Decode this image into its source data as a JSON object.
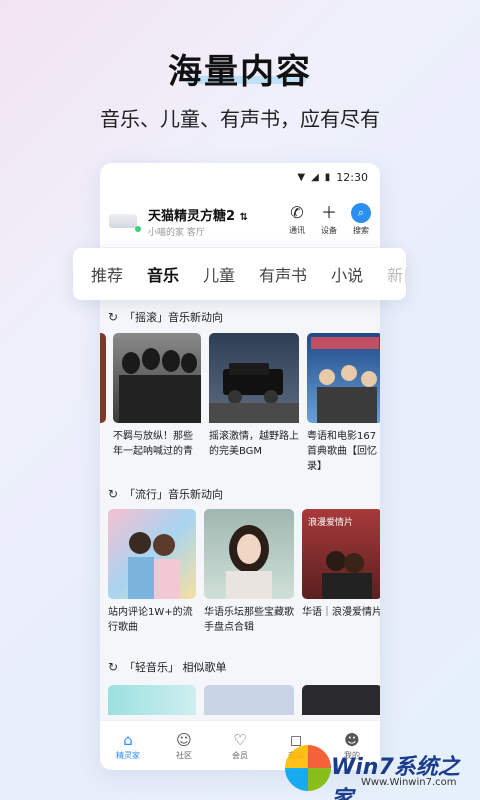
{
  "promo": {
    "headline": "海量内容",
    "subline": "音乐、儿童、有声书，应有尽有"
  },
  "status_bar": {
    "time": "12:30"
  },
  "device": {
    "name": "天猫精灵方糖2",
    "room": "小喵的家 客厅",
    "actions": [
      {
        "icon": "phone-icon",
        "label": "通讯"
      },
      {
        "icon": "plus-icon",
        "label": "设备"
      },
      {
        "icon": "search-icon",
        "label": "搜索"
      }
    ]
  },
  "tabs": [
    "推荐",
    "音乐",
    "儿童",
    "有声书",
    "小说",
    "新"
  ],
  "active_tab": "音乐",
  "sections": [
    {
      "title": "「摇滚」音乐新动向",
      "cards": [
        {
          "caption": "不羁与放纵！那些年一起呐喊过的青"
        },
        {
          "caption": "摇滚激情，越野路上的完美BGM"
        },
        {
          "caption": "粤语和电影167首典歌曲【回忆录】"
        }
      ]
    },
    {
      "title": "「流行」音乐新动向",
      "cards": [
        {
          "caption": "站内评论1W+的流行歌曲"
        },
        {
          "caption": "华语乐坛那些宝藏歌手盘点合辑"
        },
        {
          "caption": "华语｜浪漫爱情片",
          "overlay": "浪漫爱情片"
        }
      ]
    },
    {
      "title": "「轻音乐」 相似歌单",
      "cards": []
    }
  ],
  "tabbar": [
    {
      "icon": "home-icon",
      "label": "精灵家",
      "active": true
    },
    {
      "icon": "community-icon",
      "label": "社区",
      "active": false
    },
    {
      "icon": "vip-icon",
      "label": "会员",
      "active": false
    },
    {
      "icon": "store-icon",
      "label": "商城",
      "active": false
    },
    {
      "icon": "profile-icon",
      "label": "我的",
      "active": false
    }
  ],
  "watermark": {
    "brand": "Win7系统之家",
    "url": "Www.Winwin7.com"
  },
  "colors": {
    "accent": "#2a8ff0",
    "highlight": "#bfe0f7"
  }
}
